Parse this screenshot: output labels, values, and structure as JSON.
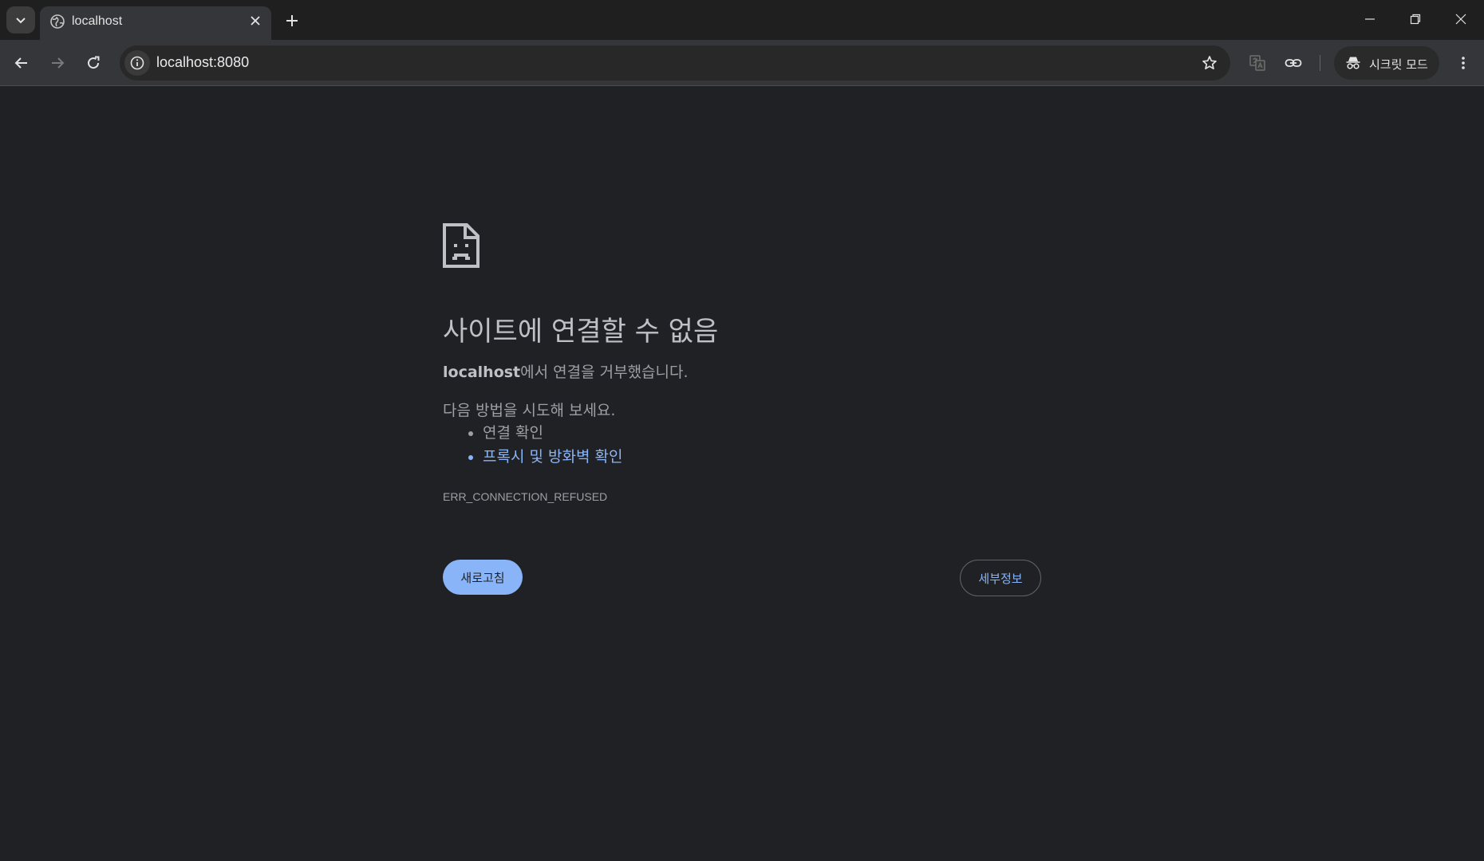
{
  "tab": {
    "title": "localhost"
  },
  "address_bar": {
    "url": "localhost:8080"
  },
  "incognito": {
    "label": "시크릿 모드"
  },
  "error_page": {
    "title": "사이트에 연결할 수 없음",
    "host": "localhost",
    "description_suffix": "에서 연결을 거부했습니다.",
    "try_label": "다음 방법을 시도해 보세요.",
    "suggestions": [
      "연결 확인",
      "프록시 및 방화벽 확인"
    ],
    "error_code": "ERR_CONNECTION_REFUSED",
    "reload_label": "새로고침",
    "details_label": "세부정보"
  },
  "colors": {
    "background": "#202124",
    "link": "#8ab4f8",
    "reload_button": "#8ab4f8"
  },
  "icons": [
    "tab-list-icon",
    "globe-icon",
    "close-icon",
    "plus-icon",
    "minimize-icon",
    "restore-icon",
    "window-close-icon",
    "back-icon",
    "forward-icon",
    "reload-icon",
    "info-icon",
    "star-icon",
    "translate-icon",
    "link-icon",
    "incognito-icon",
    "more-vert-icon",
    "sad-page-icon"
  ]
}
